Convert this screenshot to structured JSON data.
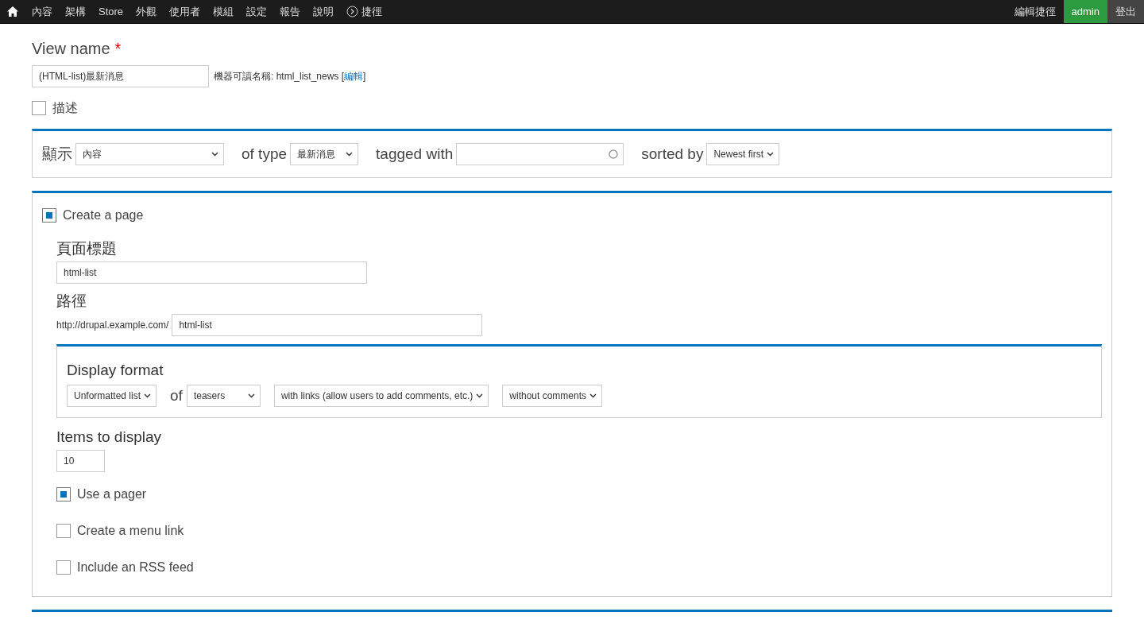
{
  "toolbar": {
    "items": [
      {
        "kind": "home"
      },
      {
        "kind": "link",
        "label": "內容"
      },
      {
        "kind": "link",
        "label": "架構"
      },
      {
        "kind": "link",
        "label": "Store"
      },
      {
        "kind": "link",
        "label": "外觀"
      },
      {
        "kind": "link",
        "label": "使用者"
      },
      {
        "kind": "link",
        "label": "模組"
      },
      {
        "kind": "link",
        "label": "設定"
      },
      {
        "kind": "link",
        "label": "報告"
      },
      {
        "kind": "link",
        "label": "說明"
      },
      {
        "kind": "shortcut",
        "label": "捷徑"
      }
    ],
    "right": [
      {
        "label": "編輯捷徑",
        "selected": false
      },
      {
        "label": "admin",
        "selected": true
      },
      {
        "label": "登出",
        "selected": false
      }
    ]
  },
  "view_name": {
    "label": "View name",
    "required_mark": "*",
    "value": "(HTML-list)最新消息",
    "machine_name": "機器可讀名稱: html_list_news [",
    "edit_link": "編輯",
    "machine_name_end": "]"
  },
  "description": {
    "label": "描述",
    "checked": false
  },
  "show": [
    {
      "kind": "select",
      "label": "顯示",
      "value": "內容"
    },
    {
      "kind": "select",
      "label": "of type",
      "value": "最新消息"
    },
    {
      "kind": "autocomplete",
      "label": "tagged with"
    },
    {
      "kind": "select",
      "label": "sorted by",
      "value": "Newest first"
    }
  ],
  "page": {
    "create": {
      "label": "Create a page",
      "checked": true
    },
    "page_title": {
      "label": "頁面標題",
      "value": "html-list"
    },
    "path": {
      "label": "路徑",
      "prefix": "http://drupal.example.com/",
      "value": "html-list"
    },
    "display_format": {
      "label": "Display format",
      "parts": [
        {
          "kind": "select",
          "value": "Unformatted list"
        },
        {
          "kind": "text",
          "text": "of"
        },
        {
          "kind": "select",
          "value": "teasers"
        },
        {
          "kind": "select",
          "value": "with links (allow users to add comments, etc.)"
        },
        {
          "kind": "select",
          "value": "without comments"
        }
      ]
    },
    "items_to_display": {
      "label": "Items to display",
      "value": "10"
    },
    "options": [
      {
        "label": "Use a pager",
        "checked": true
      },
      {
        "label": "Create a menu link",
        "checked": false
      },
      {
        "label": "Include an RSS feed",
        "checked": false
      }
    ]
  }
}
